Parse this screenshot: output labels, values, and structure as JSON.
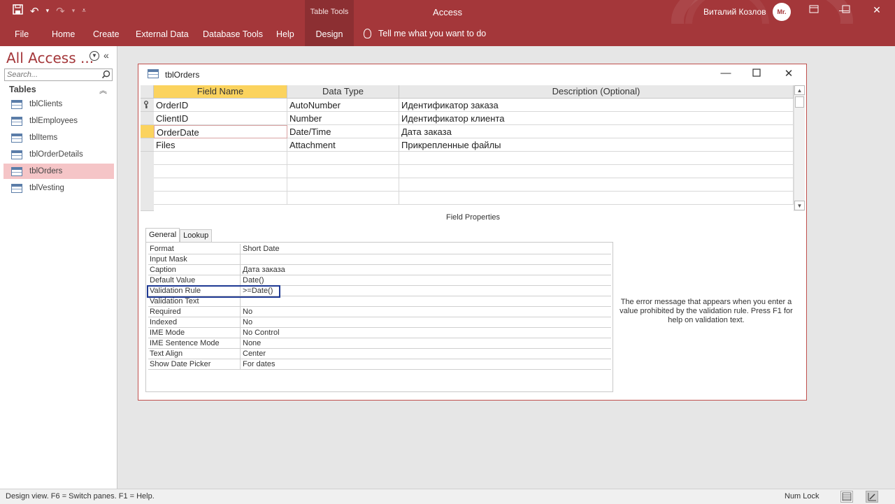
{
  "titlebar": {
    "app_title": "Access",
    "context_group": "Table Tools",
    "user_name": "Виталий Козлов",
    "avatar_text": "Mr."
  },
  "ribbon": {
    "tabs": [
      "File",
      "Home",
      "Create",
      "External Data",
      "Database Tools",
      "Help",
      "Design"
    ],
    "active_tab": "Design",
    "tell_me": "Tell me what you want to do"
  },
  "nav": {
    "title": "All Access ...",
    "search_placeholder": "Search...",
    "group": "Tables",
    "items": [
      "tblClients",
      "tblEmployees",
      "tblItems",
      "tblOrderDetails",
      "tblOrders",
      "tblVesting"
    ],
    "selected": "tblOrders"
  },
  "document": {
    "title": "tblOrders",
    "columns": [
      "Field Name",
      "Data Type",
      "Description (Optional)"
    ],
    "rows": [
      {
        "field": "OrderID",
        "type": "AutoNumber",
        "description": "Идентификатор заказа"
      },
      {
        "field": "ClientID",
        "type": "Number",
        "description": "Идентификатор клиента"
      },
      {
        "field": "OrderDate",
        "type": "Date/Time",
        "description": "Дата заказа"
      },
      {
        "field": "Files",
        "type": "Attachment",
        "description": "Прикрепленные файлы"
      }
    ],
    "field_properties_label": "Field Properties",
    "tabs": [
      "General",
      "Lookup"
    ],
    "active_tab": "General",
    "properties": [
      {
        "name": "Format",
        "value": "Short Date"
      },
      {
        "name": "Input Mask",
        "value": ""
      },
      {
        "name": "Caption",
        "value": "Дата заказа"
      },
      {
        "name": "Default Value",
        "value": "Date()"
      },
      {
        "name": "Validation Rule",
        "value": ">=Date()"
      },
      {
        "name": "Validation Text",
        "value": ""
      },
      {
        "name": "Required",
        "value": "No"
      },
      {
        "name": "Indexed",
        "value": "No"
      },
      {
        "name": "IME Mode",
        "value": "No Control"
      },
      {
        "name": "IME Sentence Mode",
        "value": "None"
      },
      {
        "name": "Text Align",
        "value": "Center"
      },
      {
        "name": "Show Date Picker",
        "value": "For dates"
      }
    ],
    "help_text": "The error message that appears when you enter a value prohibited by the validation rule. Press F1 for help on validation text."
  },
  "statusbar": {
    "left": "Design view.  F6 = Switch panes.  F1 = Help.",
    "num_lock": "Num Lock"
  },
  "colors": {
    "accent": "#a4373a",
    "active_field": "#fbd35e",
    "nav_selected": "#f5c5c7",
    "highlight_box": "#1f3a93"
  }
}
